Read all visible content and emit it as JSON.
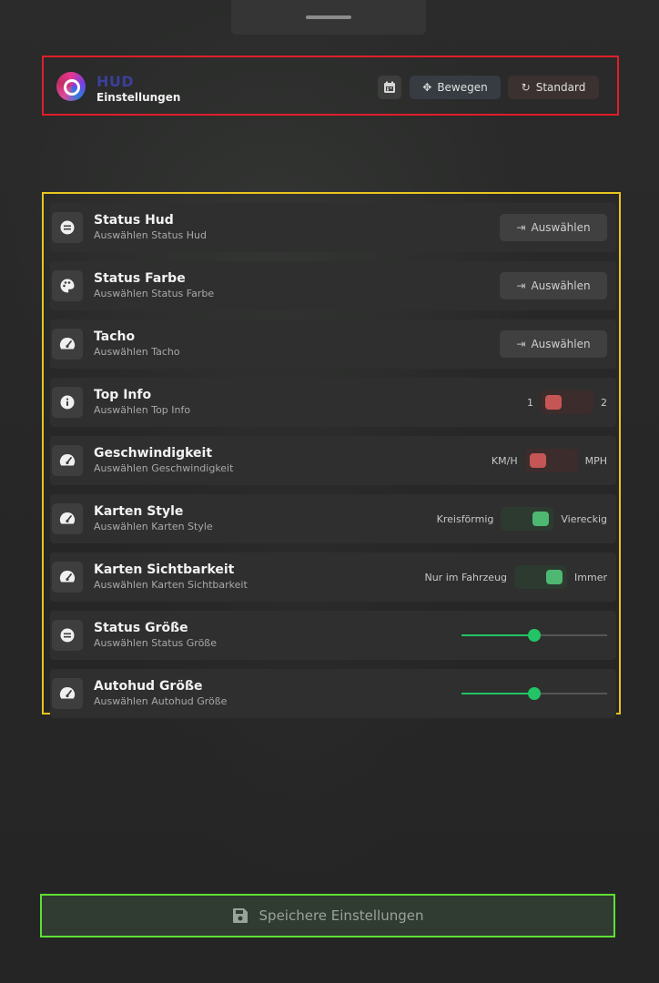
{
  "header": {
    "brand_title": "HUD",
    "brand_subtitle": "Einstellungen",
    "move_label": "Bewegen",
    "default_label": "Standard"
  },
  "settings": [
    {
      "title": "Status Hud",
      "subtitle": "Auswählen Status Hud",
      "icon": "minus-circle-icon",
      "control": "button",
      "button_label": "Auswählen"
    },
    {
      "title": "Status Farbe",
      "subtitle": "Auswählen Status Farbe",
      "icon": "palette-icon",
      "control": "button",
      "button_label": "Auswählen"
    },
    {
      "title": "Tacho",
      "subtitle": "Auswählen Tacho",
      "icon": "speedometer-icon",
      "control": "button",
      "button_label": "Auswählen"
    },
    {
      "title": "Top Info",
      "subtitle": "Auswählen Top Info",
      "icon": "info-icon",
      "control": "toggle",
      "left_label": "1",
      "right_label": "2",
      "state": "left"
    },
    {
      "title": "Geschwindigkeit",
      "subtitle": "Auswählen Geschwindigkeit",
      "icon": "speedometer-icon",
      "control": "toggle",
      "left_label": "KM/H",
      "right_label": "MPH",
      "state": "left"
    },
    {
      "title": "Karten Style",
      "subtitle": "Auswählen Karten Style",
      "icon": "speedometer-icon",
      "control": "toggle",
      "left_label": "Kreisförmig",
      "right_label": "Viereckig",
      "state": "right"
    },
    {
      "title": "Karten Sichtbarkeit",
      "subtitle": "Auswählen Karten Sichtbarkeit",
      "icon": "speedometer-icon",
      "control": "toggle",
      "left_label": "Nur im Fahrzeug",
      "right_label": "Immer",
      "state": "right"
    },
    {
      "title": "Status Größe",
      "subtitle": "Auswählen Status Größe",
      "icon": "minus-circle-icon",
      "control": "slider",
      "value": 0.5
    },
    {
      "title": "Autohud Größe",
      "subtitle": "Auswählen Autohud Größe",
      "icon": "speedometer-icon",
      "control": "slider",
      "value": 0.5
    }
  ],
  "save_label": "Speichere Einstellungen",
  "colors": {
    "header_border": "#e01e2a",
    "settings_border": "#e8c51f",
    "save_border": "#5ee034",
    "toggle_off": "#c65656",
    "toggle_on": "#4eb872",
    "slider": "#22c466"
  }
}
